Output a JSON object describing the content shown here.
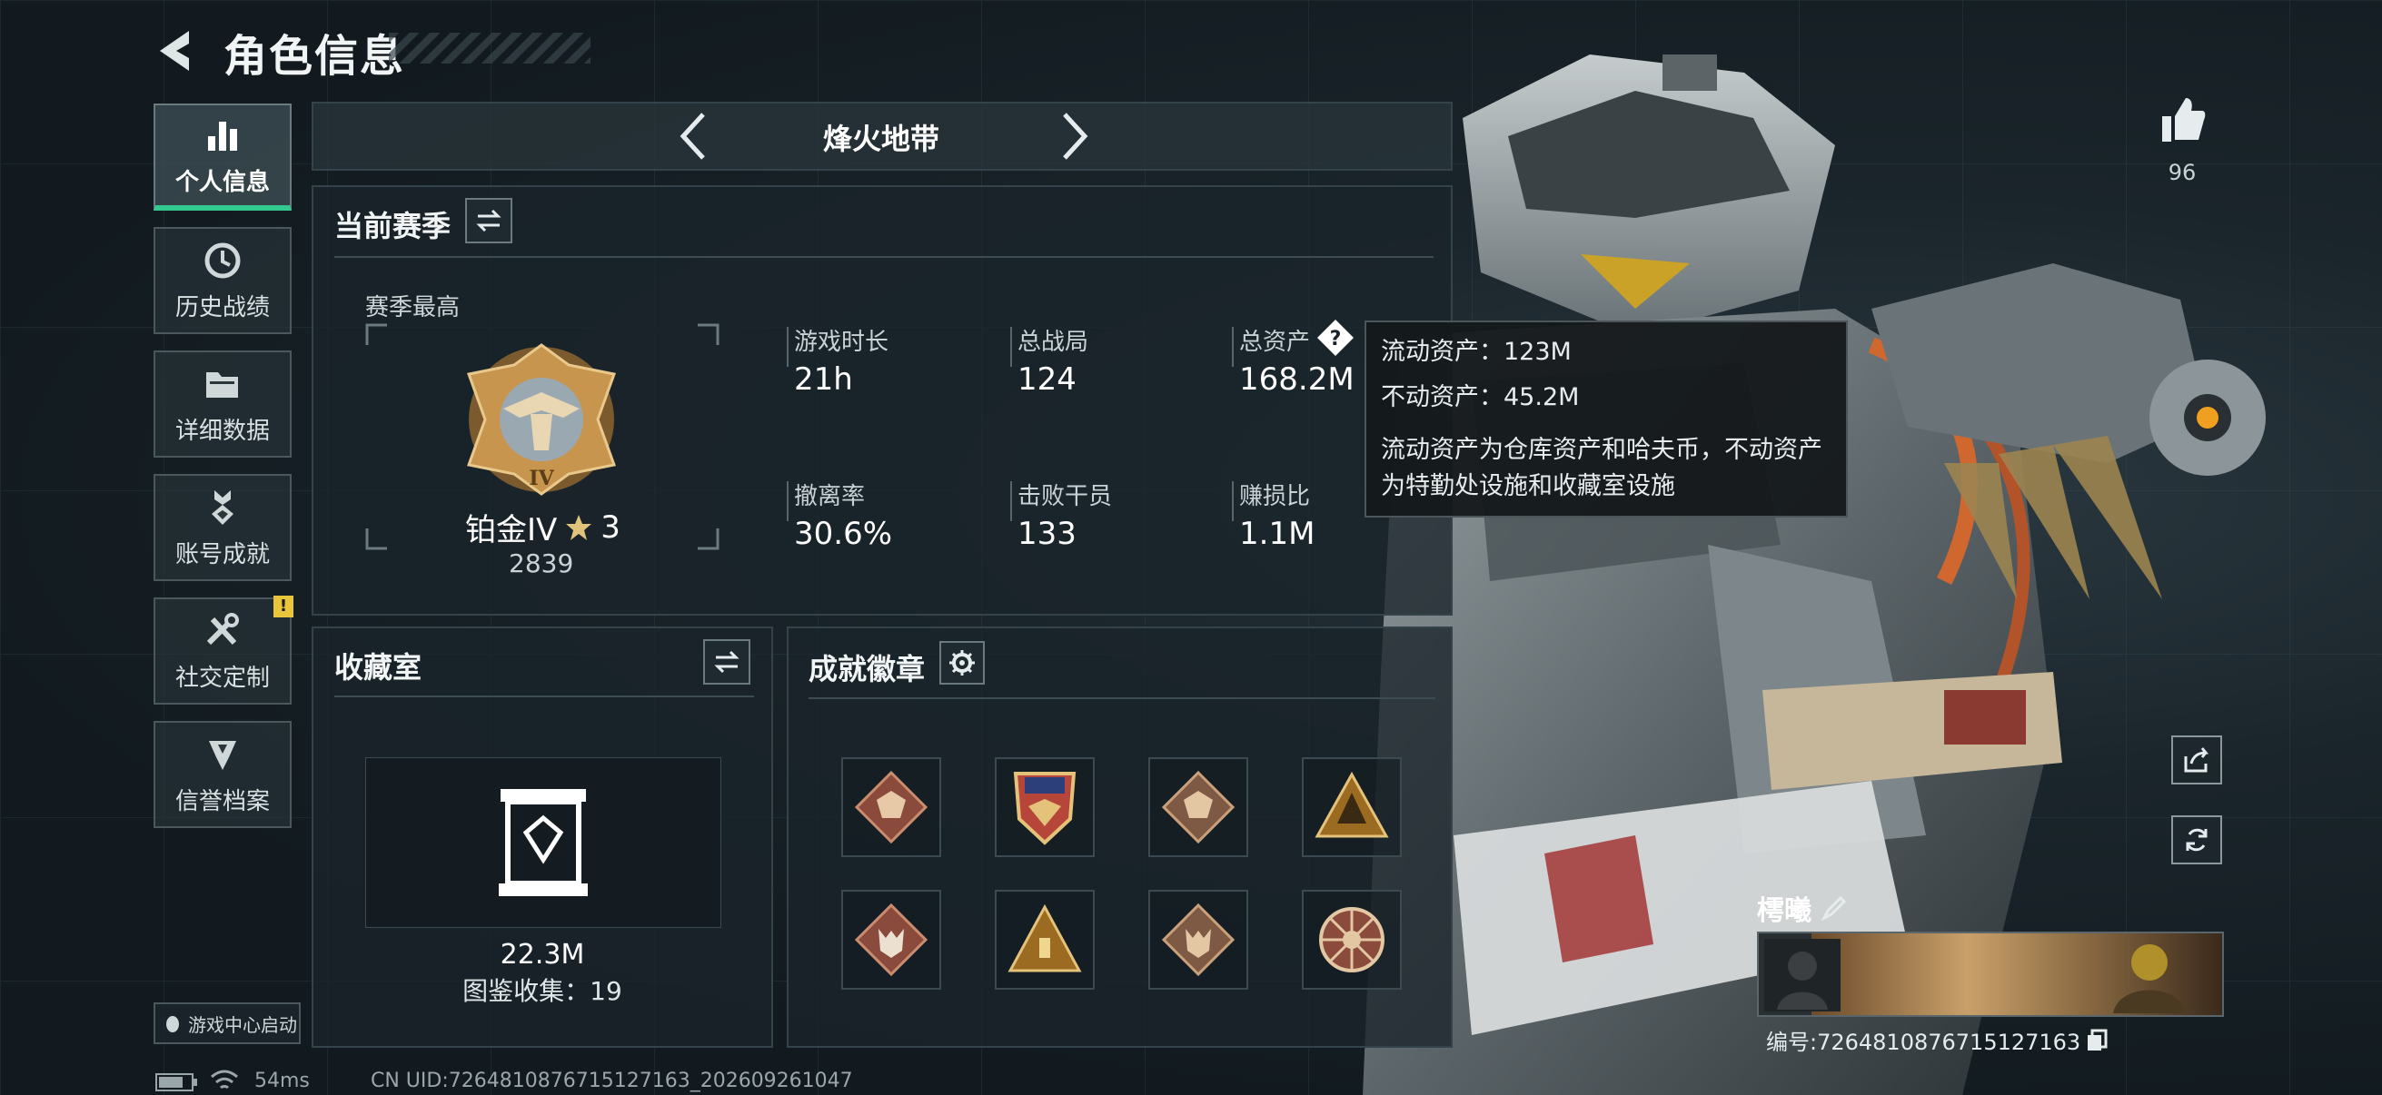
{
  "header": {
    "title": "角色信息"
  },
  "nav": {
    "items": [
      {
        "label": "个人信息",
        "active": true
      },
      {
        "label": "历史战绩"
      },
      {
        "label": "详细数据"
      },
      {
        "label": "账号成就"
      },
      {
        "label": "社交定制",
        "badge": "!"
      },
      {
        "label": "信誉档案"
      }
    ]
  },
  "game_center": "游戏中心启动",
  "mode": {
    "title": "烽火地带"
  },
  "season": {
    "title": "当前赛季",
    "best_label": "赛季最高",
    "rank_name": "铂金IV",
    "rank_stars": "3",
    "rank_points": "2839",
    "rank_emblem_text": "IV",
    "stats": [
      {
        "label": "游戏时长",
        "value": "21h"
      },
      {
        "label": "总战局",
        "value": "124"
      },
      {
        "label": "总资产",
        "value": "168.2M"
      },
      {
        "label": "撤离率",
        "value": "30.6%"
      },
      {
        "label": "击败干员",
        "value": "133"
      },
      {
        "label": "赚损比",
        "value": "1.1M"
      }
    ]
  },
  "tooltip": {
    "line1": "流动资产：123M",
    "line2": "不动资产：45.2M",
    "line3": "流动资产为仓库资产和哈夫币，不动资产",
    "line4": "为特勤处设施和收藏室设施"
  },
  "collection": {
    "title": "收藏室",
    "value": "22.3M",
    "catalog": "图鉴收集：19"
  },
  "achievements": {
    "title": "成就徽章"
  },
  "likes": {
    "count": "96"
  },
  "player": {
    "name": "樗曦",
    "uid_line": "编号:7264810876715127163"
  },
  "status": {
    "ping": "54ms",
    "uid": "CN UID:7264810876715127163_202609261047"
  },
  "colors": {
    "accent": "#34c98f",
    "badge_yellow": "#e8c53a",
    "gold": "#c8954f"
  }
}
